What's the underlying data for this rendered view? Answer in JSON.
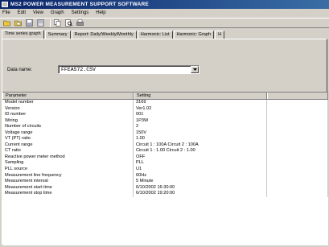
{
  "window": {
    "title": "MS2 POWER MEASUREMENT SUPPORT SOFTWARE"
  },
  "menu": {
    "items": [
      "File",
      "Edit",
      "View",
      "Graph",
      "Settings",
      "Help"
    ]
  },
  "toolbar": {
    "buttons": [
      {
        "icon": "open-folder-icon"
      },
      {
        "icon": "open-folder-icon"
      },
      {
        "icon": "save-icon"
      },
      {
        "icon": "disk-icon"
      },
      {
        "icon": "copy-icon"
      },
      {
        "icon": "print-preview-icon"
      },
      {
        "icon": "print-icon"
      }
    ]
  },
  "tabs": [
    {
      "label": "Time series graph",
      "active": true
    },
    {
      "label": "Summary",
      "active": false
    },
    {
      "label": "Report: Daily/Weekly/Monthly",
      "active": false
    },
    {
      "label": "Harmonic: List",
      "active": false
    },
    {
      "label": "Harmonic: Graph",
      "active": false
    },
    {
      "label": "H",
      "active": false
    }
  ],
  "data_name": {
    "label": "Data name:",
    "value": "FFEA572.CSV"
  },
  "table": {
    "columns": [
      "Parameter",
      "Setting"
    ],
    "rows": [
      [
        "Model number",
        "3169"
      ],
      [
        "Version",
        "Ver1.02"
      ],
      [
        "ID number",
        "001"
      ],
      [
        "Wiring",
        "1P3W"
      ],
      [
        "Number of circuits",
        "2"
      ],
      [
        "Voltage range",
        "150V"
      ],
      [
        "VT (PT) ratio",
        "1.00"
      ],
      [
        "Current range",
        "Circuit 1 : 100A Circuit 2 : 100A"
      ],
      [
        "CT ratio",
        "Circuit 1 : 1.00 Circuit 2 : 1.00"
      ],
      [
        "Reactive power meter method",
        "OFF"
      ],
      [
        "Sampling",
        "PLL"
      ],
      [
        "PLL source",
        "U1"
      ],
      [
        "Measurement line frequency",
        "60Hz"
      ],
      [
        "Measurement interval",
        "5 Minute"
      ],
      [
        "Measurement start time",
        "6/10/2002 16:30:00"
      ],
      [
        "Measurement stop time",
        "6/10/2002 19:20:00"
      ]
    ]
  }
}
